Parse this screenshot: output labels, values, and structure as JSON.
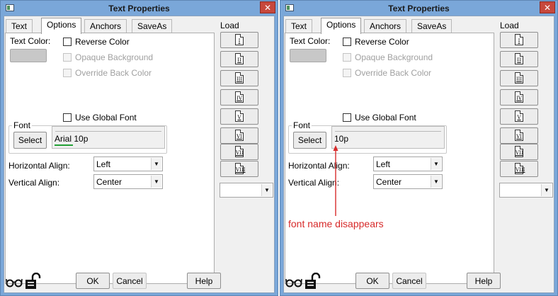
{
  "window": {
    "title": "Text Properties",
    "close_glyph": "✕"
  },
  "tabs": [
    {
      "label": "Text",
      "active": false
    },
    {
      "label": "Options",
      "active": true
    },
    {
      "label": "Anchors",
      "active": false
    },
    {
      "label": "SaveAs",
      "active": false
    }
  ],
  "options": {
    "text_color_label": "Text Color:",
    "reverse_color": "Reverse Color",
    "opaque_background": "Opaque Background",
    "override_back_color": "Override Back Color",
    "use_global_font": "Use Global Font",
    "font_group_label": "Font",
    "select_button": "Select",
    "horizontal_align_label": "Horizontal Align:",
    "horizontal_align_value": "Left",
    "vertical_align_label": "Vertical Align:",
    "vertical_align_value": "Center"
  },
  "font_display": {
    "left_name": "Arial",
    "left_size": "10p",
    "right_text": "10p"
  },
  "load": {
    "label": "Load",
    "buttons": [
      "I",
      "II",
      "III",
      "IV",
      "V",
      "VI",
      "VII",
      "VIII"
    ]
  },
  "footer": {
    "ok": "OK",
    "cancel": "Cancel",
    "help": "Help"
  },
  "icons": {
    "glasses": "glasses-icon",
    "lock": "unlocked-padlock-icon",
    "dropdown": "chevron-down-icon",
    "document": "document-icon"
  },
  "annotation": {
    "text": "font name disappears",
    "color": "#d72a2a"
  },
  "colors": {
    "title_bar": "#7aa7d9",
    "close_button": "#c7483c",
    "text_color_swatch": "#c8c8c8",
    "underline": "#22a035"
  }
}
